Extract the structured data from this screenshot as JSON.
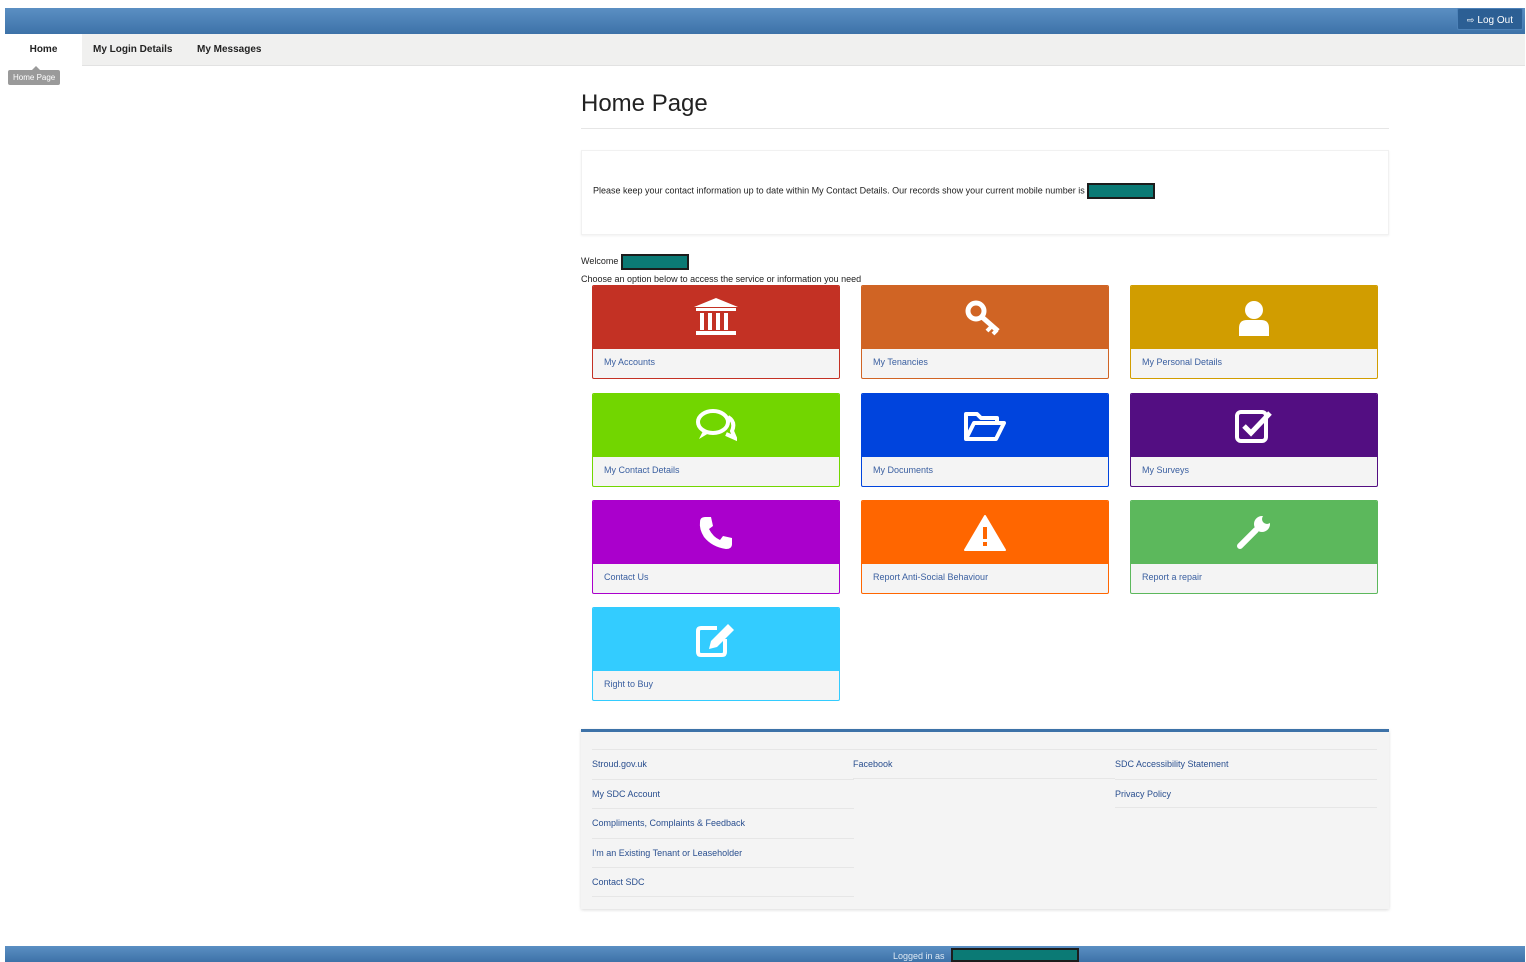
{
  "header": {
    "logout_label": "Log Out",
    "logout_icon": "logout-icon"
  },
  "nav": {
    "items": [
      {
        "label": "Home"
      },
      {
        "label": "My Login Details"
      },
      {
        "label": "My Messages"
      }
    ],
    "tooltip": "Home Page"
  },
  "page": {
    "title": "Home Page",
    "notice": "Please keep your contact information up to date within My Contact Details. Our records show your current mobile number is",
    "welcome": "Welcome",
    "choose": "Choose an option below to access the service or information you need"
  },
  "tiles": [
    {
      "label": "My Accounts",
      "icon": "bank-icon",
      "color": "#c33124"
    },
    {
      "label": "My Tenancies",
      "icon": "key-icon",
      "color": "#d06424"
    },
    {
      "label": "My Personal Details",
      "icon": "user-icon",
      "color": "#d19d00"
    },
    {
      "label": "My Contact Details",
      "icon": "chat-icon",
      "color": "#72d600"
    },
    {
      "label": "My Documents",
      "icon": "folder-open-icon",
      "color": "#0044dd"
    },
    {
      "label": "My Surveys",
      "icon": "check-square-icon",
      "color": "#530e82"
    },
    {
      "label": "Contact Us",
      "icon": "phone-icon",
      "color": "#aa00cc"
    },
    {
      "label": "Report Anti-Social Behaviour",
      "icon": "warning-icon",
      "color": "#ff6600"
    },
    {
      "label": "Report a repair",
      "icon": "wrench-icon",
      "color": "#5cb85c"
    },
    {
      "label": "Right to Buy",
      "icon": "edit-icon",
      "color": "#33ccff"
    }
  ],
  "footer": {
    "col1": [
      "Stroud.gov.uk",
      "My SDC Account",
      "Compliments, Complaints & Feedback",
      "I'm an Existing Tenant or Leaseholder",
      "Contact SDC"
    ],
    "col2": [
      "Facebook"
    ],
    "col3": [
      "SDC Accessibility Statement",
      "Privacy Policy"
    ]
  },
  "status": {
    "logged_in_label": "Logged in as"
  }
}
